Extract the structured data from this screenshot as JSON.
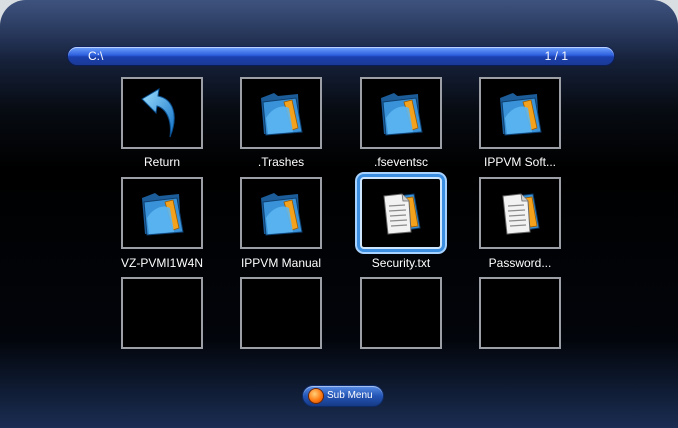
{
  "pathbar": {
    "path": "C:\\",
    "page": "1 / 1"
  },
  "items": [
    {
      "label": "Return",
      "icon": "return-arrow-icon"
    },
    {
      "label": ".Trashes",
      "icon": "folder-icon"
    },
    {
      "label": ".fseventsc",
      "icon": "folder-icon"
    },
    {
      "label": "IPPVM Soft...",
      "icon": "folder-icon"
    },
    {
      "label": "VZ-PVMI1W4N",
      "icon": "folder-icon"
    },
    {
      "label": "IPPVM Manual",
      "icon": "folder-icon"
    },
    {
      "label": "Security.txt",
      "icon": "text-file-icon",
      "selected": true
    },
    {
      "label": "Password...",
      "icon": "text-file-icon"
    }
  ],
  "footer": {
    "submenu_label": "Sub Menu"
  },
  "colors": {
    "accent_blue": "#2d5fe0",
    "folder_blue": "#3a93d8",
    "folder_orange": "#f4a21c",
    "selection": "#3c8fe0"
  }
}
